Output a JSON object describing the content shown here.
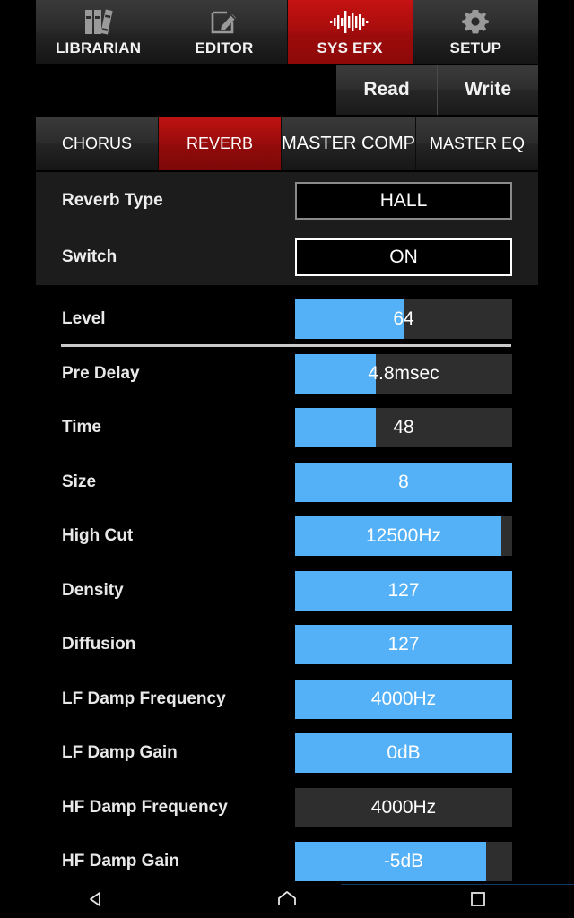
{
  "main_tabs": [
    {
      "label": "LIBRARIAN",
      "icon": "books-icon",
      "active": false
    },
    {
      "label": "EDITOR",
      "icon": "pencil-square-icon",
      "active": false
    },
    {
      "label": "SYS EFX",
      "icon": "waveform-icon",
      "active": true
    },
    {
      "label": "SETUP",
      "icon": "gear-icon",
      "active": false
    }
  ],
  "actions": {
    "read_label": "Read",
    "write_label": "Write"
  },
  "sub_tabs": [
    {
      "label": "CHORUS",
      "active": false
    },
    {
      "label": "REVERB",
      "active": true
    },
    {
      "label": "MASTER COMP",
      "active": false
    },
    {
      "label": "MASTER EQ",
      "active": false
    }
  ],
  "header_params": [
    {
      "label": "Reverb Type",
      "value": "HALL",
      "border": "grey"
    },
    {
      "label": "Switch",
      "value": "ON",
      "border": "white"
    }
  ],
  "sliders": [
    {
      "label": "Level",
      "value": "64",
      "fill_pct": 50,
      "divider_below": true
    },
    {
      "label": "Pre Delay",
      "value": "4.8msec",
      "fill_pct": 37,
      "divider_below": false
    },
    {
      "label": "Time",
      "value": "48",
      "fill_pct": 37,
      "divider_below": false
    },
    {
      "label": "Size",
      "value": "8",
      "fill_pct": 100,
      "divider_below": false
    },
    {
      "label": "High Cut",
      "value": "12500Hz",
      "fill_pct": 95,
      "divider_below": false
    },
    {
      "label": "Density",
      "value": "127",
      "fill_pct": 100,
      "divider_below": false
    },
    {
      "label": "Diffusion",
      "value": "127",
      "fill_pct": 100,
      "divider_below": false
    },
    {
      "label": "LF Damp Frequency",
      "value": "4000Hz",
      "fill_pct": 100,
      "divider_below": false
    },
    {
      "label": "LF Damp Gain",
      "value": "0dB",
      "fill_pct": 100,
      "divider_below": false
    },
    {
      "label": "HF Damp Frequency",
      "value": "4000Hz",
      "fill_pct": 0,
      "divider_below": false
    },
    {
      "label": "HF Damp Gain",
      "value": "-5dB",
      "fill_pct": 88,
      "divider_below": false
    }
  ],
  "navbar": [
    {
      "icon": "back-triangle-icon"
    },
    {
      "icon": "home-icon"
    },
    {
      "icon": "recents-square-icon"
    }
  ],
  "colors": {
    "accent_red": "#bf1212",
    "slider_blue": "#54b0f7",
    "track_grey": "#2e2e2e",
    "panel_grey": "#1c1c1c",
    "background": "#000000"
  }
}
